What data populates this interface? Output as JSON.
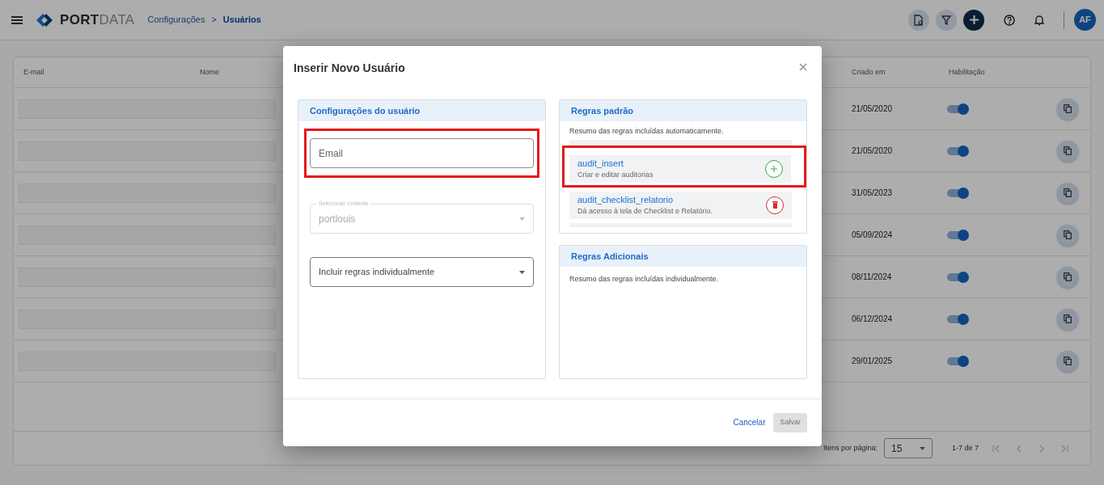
{
  "header": {
    "logo_bold": "PORT",
    "logo_light": "DATA",
    "separator": ">",
    "breadcrumbs": [
      {
        "label": "Configurações",
        "current": false
      },
      {
        "label": "Usuários",
        "current": true
      }
    ],
    "avatar": "AF"
  },
  "table": {
    "columns": [
      "E-mail",
      "Nome",
      "Criado em",
      "Habilitação"
    ],
    "rows": [
      {
        "created": "21/05/2020",
        "enabled": true
      },
      {
        "created": "21/05/2020",
        "enabled": true
      },
      {
        "created": "31/05/2023",
        "enabled": true
      },
      {
        "created": "05/09/2024",
        "enabled": true
      },
      {
        "created": "08/11/2024",
        "enabled": true
      },
      {
        "created": "06/12/2024",
        "enabled": true
      },
      {
        "created": "29/01/2025",
        "enabled": true
      }
    ]
  },
  "pagination": {
    "label": "Itens por página:",
    "page_size": "15",
    "range": "1-7 de 7"
  },
  "dialog": {
    "title": "Inserir Novo Usuário",
    "user_settings": {
      "title": "Configurações do usuário",
      "email": {
        "placeholder": "Email",
        "highlighted": true
      },
      "context": {
        "label": "Selecionar contexto",
        "value": "portlouis",
        "disabled": true
      },
      "rules_select": {
        "placeholder": "Incluir regras individualmente"
      }
    },
    "default_rules": {
      "title": "Regras padrão",
      "summary": "Resumo das regras incluídas automaticamente.",
      "items": [
        {
          "name": "audit_insert",
          "description": "Criar e editar auditorias",
          "kind": "add",
          "highlighted": true
        },
        {
          "name": "audit_checklist_relatorio",
          "description": "Dá acesso à tela de Checklist e Relatório.",
          "kind": "remove",
          "highlighted": false
        }
      ]
    },
    "additional_rules": {
      "title": "Regras Adicionais",
      "summary": "Resumo das regras incluídas individualmente."
    },
    "buttons": [
      {
        "label": "Cancelar",
        "kind": "link",
        "disabled": false
      },
      {
        "label": "Salvar",
        "kind": "flat",
        "disabled": true
      }
    ]
  }
}
